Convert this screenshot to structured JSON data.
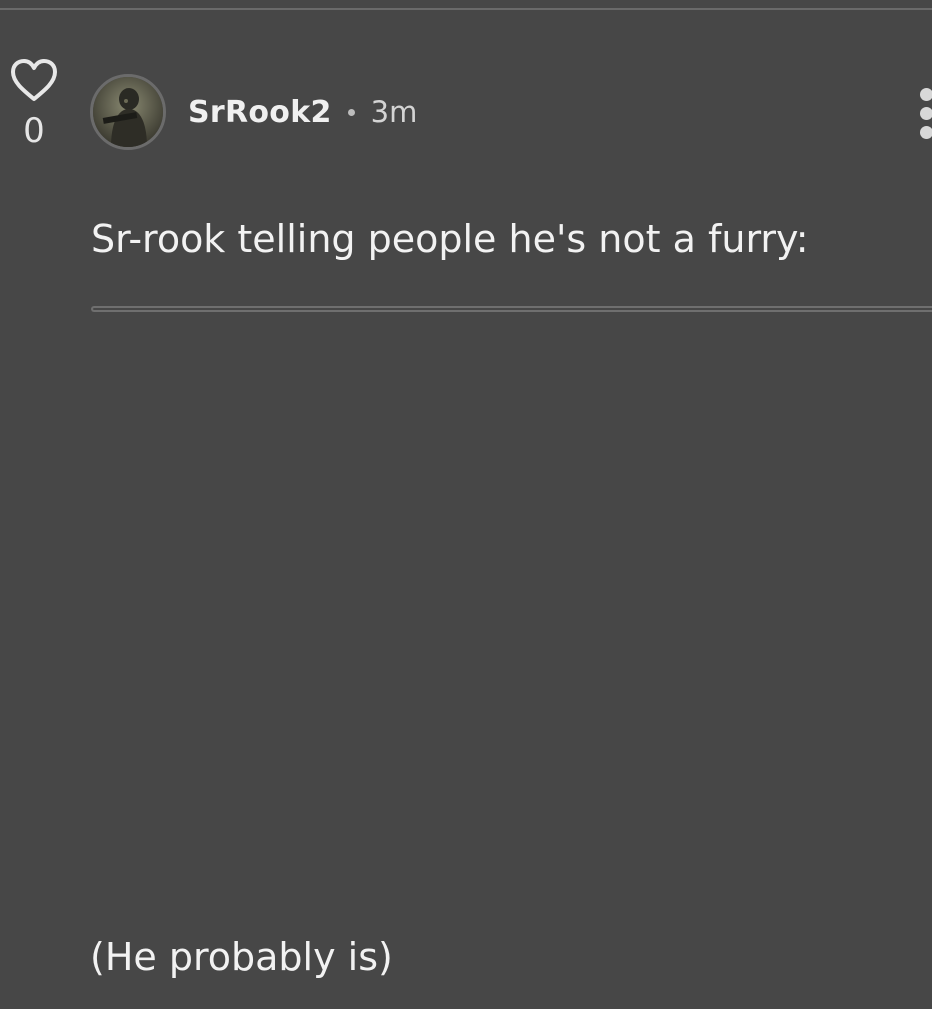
{
  "post": {
    "likes": {
      "count": "0",
      "icon": "heart-outline-icon"
    },
    "author": {
      "username": "SrRook2",
      "avatar": "avatar-soldier-image"
    },
    "separator": "•",
    "timestamp": "3m",
    "menu_icon": "more-vertical-icon",
    "body_text": "Sr-rook telling people he's not a furry:",
    "caption_text": "(He probably is)"
  },
  "colors": {
    "background": "#474747",
    "text": "#f2f2f2",
    "muted": "#d4d4d4",
    "divider": "#6f6f6f"
  }
}
